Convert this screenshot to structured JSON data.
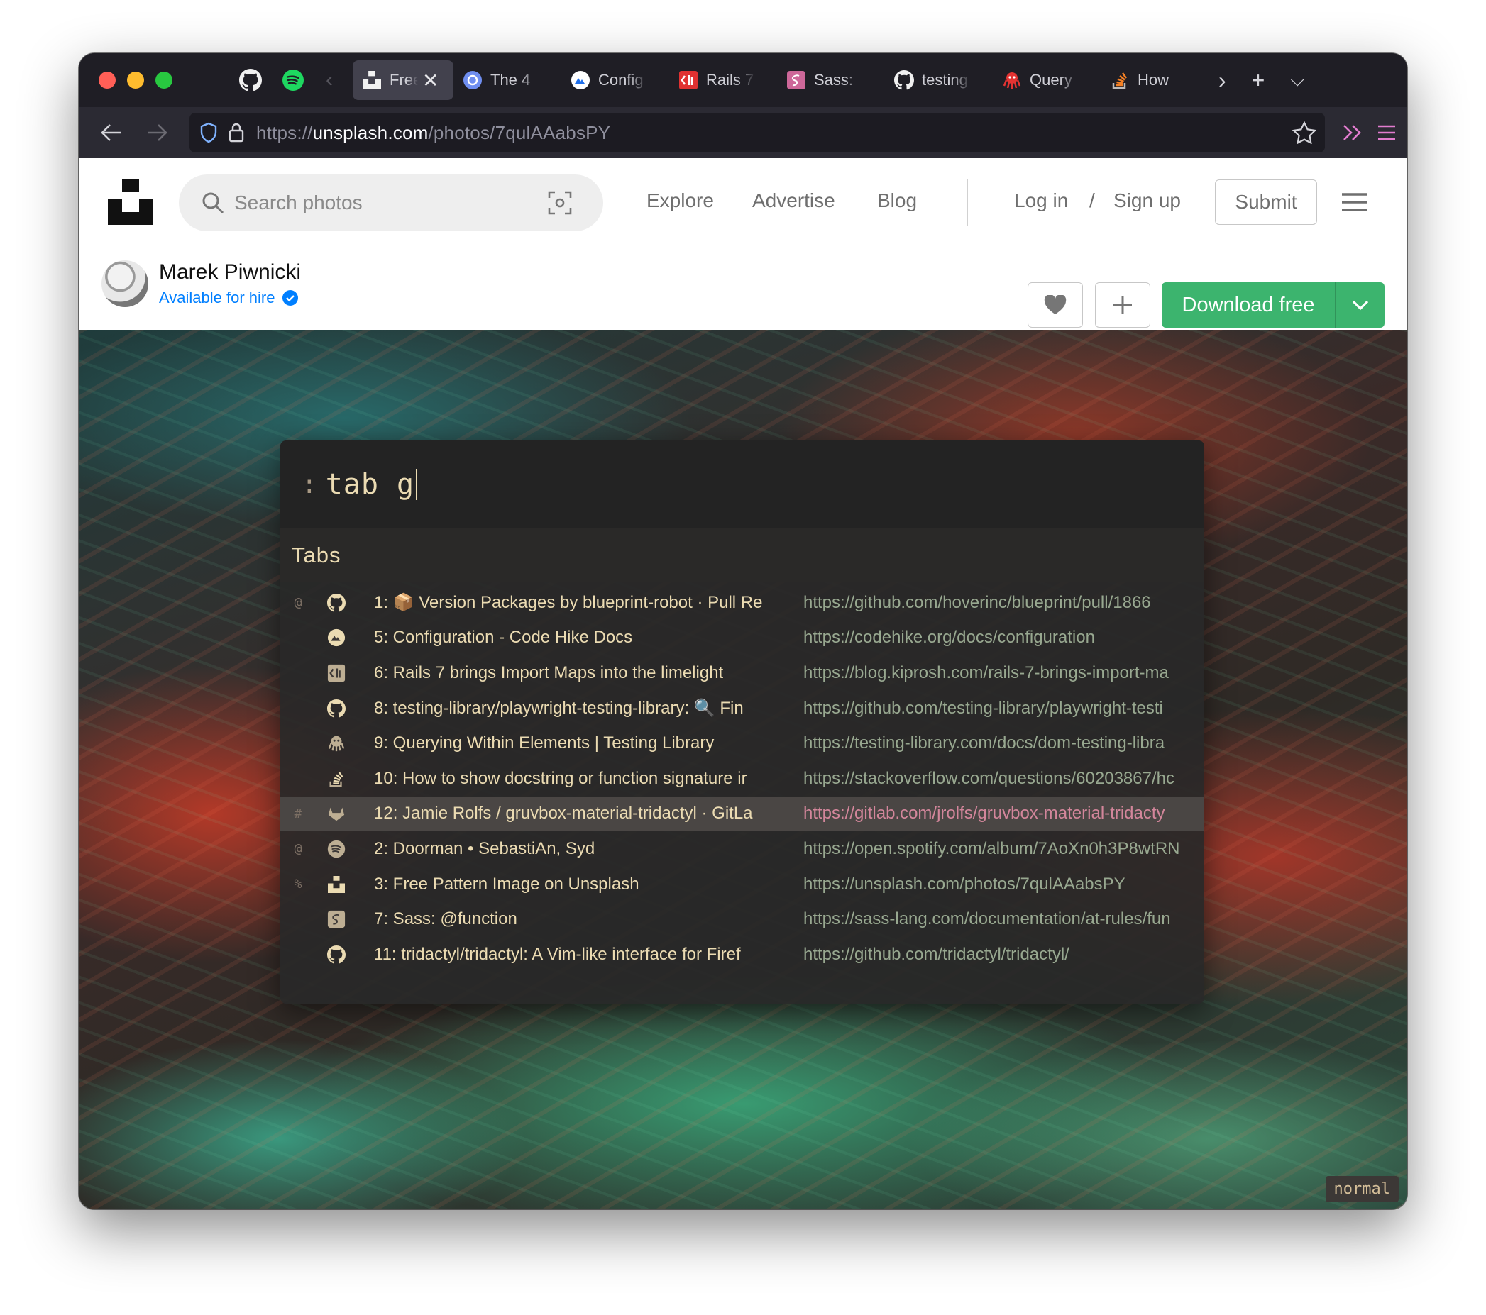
{
  "browser": {
    "pinned_tabs": [
      {
        "icon": "github-icon"
      },
      {
        "icon": "spotify-icon"
      }
    ],
    "tabs": [
      {
        "label": "Free",
        "icon": "unsplash-icon",
        "active": true
      },
      {
        "label": "The 4",
        "icon": "graphql-icon"
      },
      {
        "label": "Config",
        "icon": "codehike-icon"
      },
      {
        "label": "Rails 7",
        "icon": "kiprosh-icon"
      },
      {
        "label": "Sass:",
        "icon": "sass-icon"
      },
      {
        "label": "testing",
        "icon": "github-icon"
      },
      {
        "label": "Query",
        "icon": "octopus-icon"
      },
      {
        "label": "How",
        "icon": "stackoverflow-icon"
      }
    ],
    "url": {
      "scheme": "https://",
      "host": "unsplash.com",
      "path": "/photos/7qulAAabsPY"
    }
  },
  "site": {
    "search_placeholder": "Search photos",
    "nav": {
      "explore": "Explore",
      "advertise": "Advertise",
      "blog": "Blog",
      "login": "Log in",
      "sep": "/",
      "signup": "Sign up",
      "submit": "Submit"
    }
  },
  "photo": {
    "author": "Marek Piwnicki",
    "hire": "Available for hire",
    "download": "Download free"
  },
  "tridactyl": {
    "prompt": ":",
    "command": "tab g",
    "section": "Tabs",
    "mode": "normal",
    "rows": [
      {
        "flag": "@",
        "icon": "github-icon",
        "title": "1: 📦 Version Packages by blueprint-robot · Pull Re",
        "url": "https://github.com/hoverinc/blueprint/pull/1866"
      },
      {
        "flag": "",
        "icon": "codehike-icon",
        "title": "5: Configuration - Code Hike Docs",
        "url": "https://codehike.org/docs/configuration"
      },
      {
        "flag": "",
        "icon": "kiprosh-icon",
        "title": "6: Rails 7 brings Import Maps into the limelight",
        "url": "https://blog.kiprosh.com/rails-7-brings-import-ma"
      },
      {
        "flag": "",
        "icon": "github-icon",
        "title": "8: testing-library/playwright-testing-library: 🔍 Fin",
        "url": "https://github.com/testing-library/playwright-testi"
      },
      {
        "flag": "",
        "icon": "octopus-icon",
        "title": "9: Querying Within Elements | Testing Library",
        "url": "https://testing-library.com/docs/dom-testing-libra"
      },
      {
        "flag": "",
        "icon": "stackoverflow-icon",
        "title": "10: How to show docstring or function signature ir",
        "url": "https://stackoverflow.com/questions/60203867/hc"
      },
      {
        "flag": "#",
        "icon": "gitlab-icon",
        "title": "12: Jamie Rolfs / gruvbox-material-tridactyl · GitLa",
        "url": "https://gitlab.com/jrolfs/gruvbox-material-tridacty",
        "selected": true
      },
      {
        "flag": "@",
        "icon": "spotify-icon",
        "title": "2: Doorman • SebastiAn, Syd",
        "url": "https://open.spotify.com/album/7AoXn0h3P8wtRN"
      },
      {
        "flag": "%",
        "icon": "unsplash-icon",
        "title": "3: Free Pattern Image on Unsplash",
        "url": "https://unsplash.com/photos/7qulAAabsPY"
      },
      {
        "flag": "",
        "icon": "sass-icon",
        "title": "7: Sass: @function",
        "url": "https://sass-lang.com/documentation/at-rules/fun"
      },
      {
        "flag": "",
        "icon": "github-icon",
        "title": "11: tridactyl/tridactyl: A Vim-like interface for Firef",
        "url": "https://github.com/tridactyl/tridactyl/"
      }
    ]
  },
  "colors": {
    "download_green": "#3cb46e",
    "accent_blue": "#007fff",
    "gruvbox_fg": "#ebdbb2",
    "selected_url": "#d3869b"
  }
}
